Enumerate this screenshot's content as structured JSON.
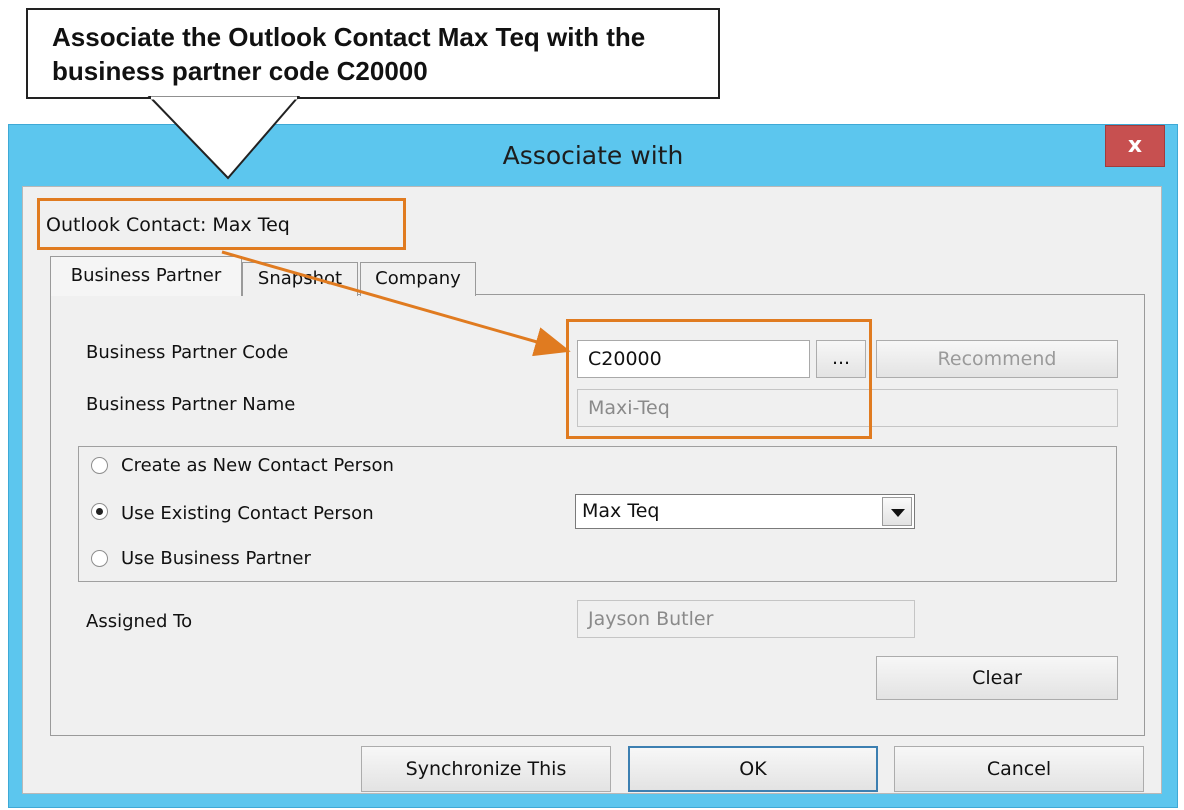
{
  "callout": {
    "line1": "Associate the Outlook Contact Max  Teq with the",
    "line2": "business partner code C20000"
  },
  "window": {
    "title": "Associate with",
    "close_glyph": "x"
  },
  "contact": {
    "label": "Outlook Contact: Max Teq"
  },
  "tabs": [
    {
      "label": "Business Partner",
      "active": true
    },
    {
      "label": "Snapshot",
      "active": false
    },
    {
      "label": "Company",
      "active": false
    }
  ],
  "bp": {
    "code_label": "Business Partner Code",
    "code_value": "C20000",
    "browse_label": "...",
    "recommend_label": "Recommend",
    "name_label": "Business Partner Name",
    "name_value": "Maxi-Teq"
  },
  "options": {
    "new_contact": "Create as New Contact Person",
    "existing_contact": "Use Existing Contact Person",
    "use_bp": "Use Business Partner",
    "selected": "existing_contact",
    "contact_select_value": "Max Teq"
  },
  "assigned": {
    "label": "Assigned To",
    "value": "Jayson Butler"
  },
  "buttons": {
    "clear": "Clear",
    "sync": "Synchronize This",
    "ok": "OK",
    "cancel": "Cancel"
  },
  "colors": {
    "highlight": "#e07b20",
    "titlebar": "#5cc6ee",
    "close": "#c75050"
  }
}
